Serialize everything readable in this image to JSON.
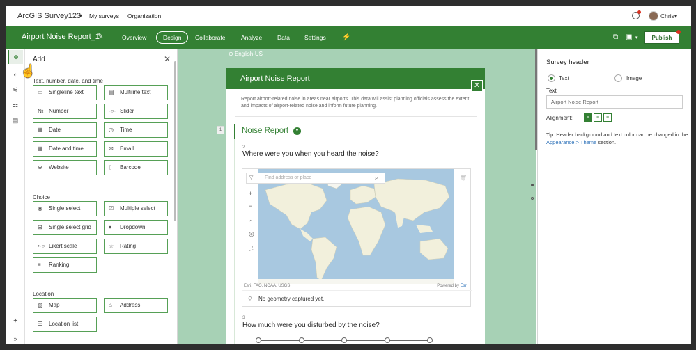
{
  "app": {
    "title": "ArcGIS Survey123",
    "caret": "▾",
    "nav": [
      "My surveys",
      "Organization"
    ],
    "user": "Chris▾"
  },
  "survey": {
    "name": "Airport Noise Report_1",
    "tabs": [
      "Overview",
      "Design",
      "Collaborate",
      "Analyze",
      "Data",
      "Settings"
    ],
    "active_tab": "Design",
    "publish_label": "Publish"
  },
  "add_panel": {
    "title": "Add",
    "sections": [
      {
        "title": "Text, number, date, and time",
        "items": [
          {
            "label": "Singleline text",
            "icon": "singleline-text-icon",
            "glyph": "▭"
          },
          {
            "label": "Multiline text",
            "icon": "multiline-text-icon",
            "glyph": "▤"
          },
          {
            "label": "Number",
            "icon": "number-icon",
            "glyph": "№"
          },
          {
            "label": "Slider",
            "icon": "slider-icon",
            "glyph": "-○-"
          },
          {
            "label": "Date",
            "icon": "date-icon",
            "glyph": "▦"
          },
          {
            "label": "Time",
            "icon": "time-icon",
            "glyph": "◷"
          },
          {
            "label": "Date and time",
            "icon": "date-time-icon",
            "glyph": "▦"
          },
          {
            "label": "Email",
            "icon": "email-icon",
            "glyph": "✉"
          },
          {
            "label": "Website",
            "icon": "website-icon",
            "glyph": "⊕"
          },
          {
            "label": "Barcode",
            "icon": "barcode-icon",
            "glyph": "⌷"
          }
        ]
      },
      {
        "title": "Choice",
        "items": [
          {
            "label": "Single select",
            "icon": "single-select-icon",
            "glyph": "◉"
          },
          {
            "label": "Multiple select",
            "icon": "multiple-select-icon",
            "glyph": "☑"
          },
          {
            "label": "Single select grid",
            "icon": "single-select-grid-icon",
            "glyph": "⊞"
          },
          {
            "label": "Dropdown",
            "icon": "dropdown-icon",
            "glyph": "▾"
          },
          {
            "label": "Likert scale",
            "icon": "likert-scale-icon",
            "glyph": "•-○"
          },
          {
            "label": "Rating",
            "icon": "rating-icon",
            "glyph": "☆"
          },
          {
            "label": "Ranking",
            "icon": "ranking-icon",
            "glyph": "≡"
          }
        ]
      },
      {
        "title": "Location",
        "items": [
          {
            "label": "Map",
            "icon": "map-icon",
            "glyph": "▧"
          },
          {
            "label": "Address",
            "icon": "address-icon",
            "glyph": "⌂"
          },
          {
            "label": "Location list",
            "icon": "location-list-icon",
            "glyph": "☰"
          }
        ]
      }
    ]
  },
  "canvas": {
    "language": "English-US",
    "form_title": "Airport Noise Report",
    "description": "Report airport-related noise in areas near airports. This data will assist planning officials assess the extent and impacts of airport-related noise and inform future planning.",
    "page_number": "1",
    "group_title": "Noise Report",
    "questions": [
      {
        "num": "2",
        "text": "Where were you when you heard the noise?"
      },
      {
        "num": "3",
        "text": "How much were you disturbed by the noise?"
      }
    ],
    "map": {
      "search_placeholder": "Find address or place",
      "attribution": "Esri, FAO, NOAA, USGS",
      "powered_by": "Powered by ",
      "powered_by_link": "Esri",
      "status": "No geometry captured yet."
    },
    "slider_stops": 5
  },
  "right_panel": {
    "title": "Survey header",
    "option_text": "Text",
    "option_image": "Image",
    "text_label": "Text",
    "text_value": "Airport Noise Report",
    "alignment_label": "Alignment:",
    "tip_prefix": "Tip: Header background and text color can be changed in the ",
    "tip_link": "Appearance > Theme",
    "tip_suffix": " section."
  },
  "colors": {
    "brand_green": "#338033",
    "canvas_bg": "#a7d1b5",
    "alert_red": "#d83020",
    "link_blue": "#2b70b8"
  }
}
